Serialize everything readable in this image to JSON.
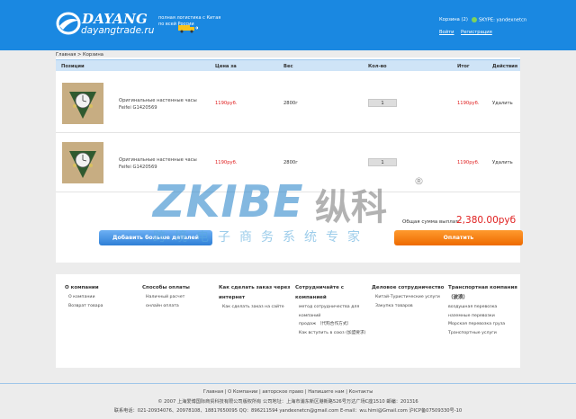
{
  "header": {
    "logo_text": "DAYANG",
    "logo_sub": "dayangtrade.ru",
    "tagline": "полная логистика с Китая по всей России",
    "cart": "Корзина (2)",
    "skype": "SKYPE: yandexnetcn",
    "login": "Войти",
    "register": "Регистрация"
  },
  "breadcrumb": "Главная > Корзина",
  "table": {
    "headers": [
      "Позиции",
      "Цена за",
      "Вес",
      "Кол-во",
      "Итог",
      "Действия"
    ],
    "rows": [
      {
        "name": "Оригинальные настенные часы Feifei G1420569",
        "price": "1190руб.",
        "weight": "2800г",
        "qty": "1",
        "total": "1190руб.",
        "action": "Удалить"
      },
      {
        "name": "Оригинальные настенные часы Feifei G1420569",
        "price": "1190руб.",
        "weight": "2800г",
        "qty": "1",
        "total": "1190руб.",
        "action": "Удалить"
      }
    ]
  },
  "summary": {
    "label": "Общая сумма выплат :",
    "value": "2,380.00руб"
  },
  "buttons": {
    "more": "Добавить больше деталей",
    "pay": "Оплатить"
  },
  "watermark": {
    "brand": "ZKIBE",
    "brand_cn": "纵科",
    "reg": "®",
    "slogan": "跨境电子商务系统专家"
  },
  "footer_cols": [
    {
      "title": "О компании",
      "links": [
        "О компании",
        "Возврат товара"
      ]
    },
    {
      "title": "Способы оплаты",
      "links": [
        "Наличный расчет",
        "онлайн оплата"
      ]
    },
    {
      "title": "Как сделать заказ через интернет",
      "links": [
        "Как сделать заказ на сайте"
      ]
    },
    {
      "title": "Сотрудничайте с компанией",
      "links": [
        "метод сотрудничества для компаний",
        "продаж （代购合作方式）",
        "Как вступить в союз (加盟要求)"
      ]
    },
    {
      "title": "Деловое сотрудничество",
      "links": [
        "Китай-Туристические услуги",
        "Закупка товаров"
      ]
    },
    {
      "title": "Транспортная компания （波浪）",
      "links": [
        "воздушная перевозка",
        "наземные перевозки",
        "Морская перевозка груза",
        "Транспортные услуги"
      ]
    }
  ],
  "footer": {
    "nav": "Главная | О Компании | авторское право | Напишите нам | Контакты",
    "copyright": "© 2007 上海爱博国际商贸科技有限公司版权所有    公司地址：上海市浦东新区港新路526号万达广场C座1510    邮编：201316",
    "contact": "联系电话：021-20934076、20978108、18817650095    QQ：896211594    yandexnetcn@gmail.com    E-mail：wu.himi@Gmail.com    沪ICP备07509330号-10"
  }
}
